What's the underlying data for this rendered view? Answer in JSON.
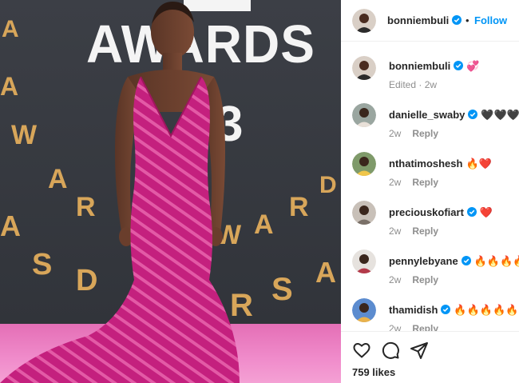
{
  "photo": {
    "backdrop_big_word": "AWARDS",
    "backdrop_big_number": "3",
    "backdrop_gold_letters": [
      "A",
      "W",
      "A",
      "R",
      "D",
      "S",
      "A",
      "W",
      "A",
      "R",
      "D",
      "S"
    ]
  },
  "header": {
    "username": "bonniembuli",
    "separator": "•",
    "follow_label": "Follow"
  },
  "caption": {
    "username": "bonniembuli",
    "text": "💞",
    "meta": "Edited · 2w"
  },
  "comments": [
    {
      "username": "danielle_swaby",
      "verified": true,
      "text": "🖤🖤🖤go",
      "age": "2w",
      "reply_label": "Reply"
    },
    {
      "username": "nthatimoshesh",
      "verified": false,
      "text": "🔥❤️",
      "age": "2w",
      "reply_label": "Reply"
    },
    {
      "username": "preciouskofiart",
      "verified": true,
      "text": "❤️",
      "age": "2w",
      "reply_label": "Reply"
    },
    {
      "username": "pennylebyane",
      "verified": true,
      "text": "🔥🔥🔥🔥",
      "age": "2w",
      "reply_label": "Reply"
    },
    {
      "username": "thamidish",
      "verified": true,
      "text": "🔥🔥🔥🔥🔥",
      "age": "2w",
      "reply_label": "Reply"
    }
  ],
  "actions": {
    "icons": [
      "heart-icon",
      "comment-icon",
      "share-icon"
    ]
  },
  "likes_text": "759 likes",
  "colors": {
    "follow_blue": "#0095f6",
    "verified_blue": "#0095f6",
    "dress_magenta": "#c4207e",
    "carpet_pink": "#ef8ac9",
    "backdrop_dark": "#34373d",
    "gold_letters": "#d8a65a"
  }
}
